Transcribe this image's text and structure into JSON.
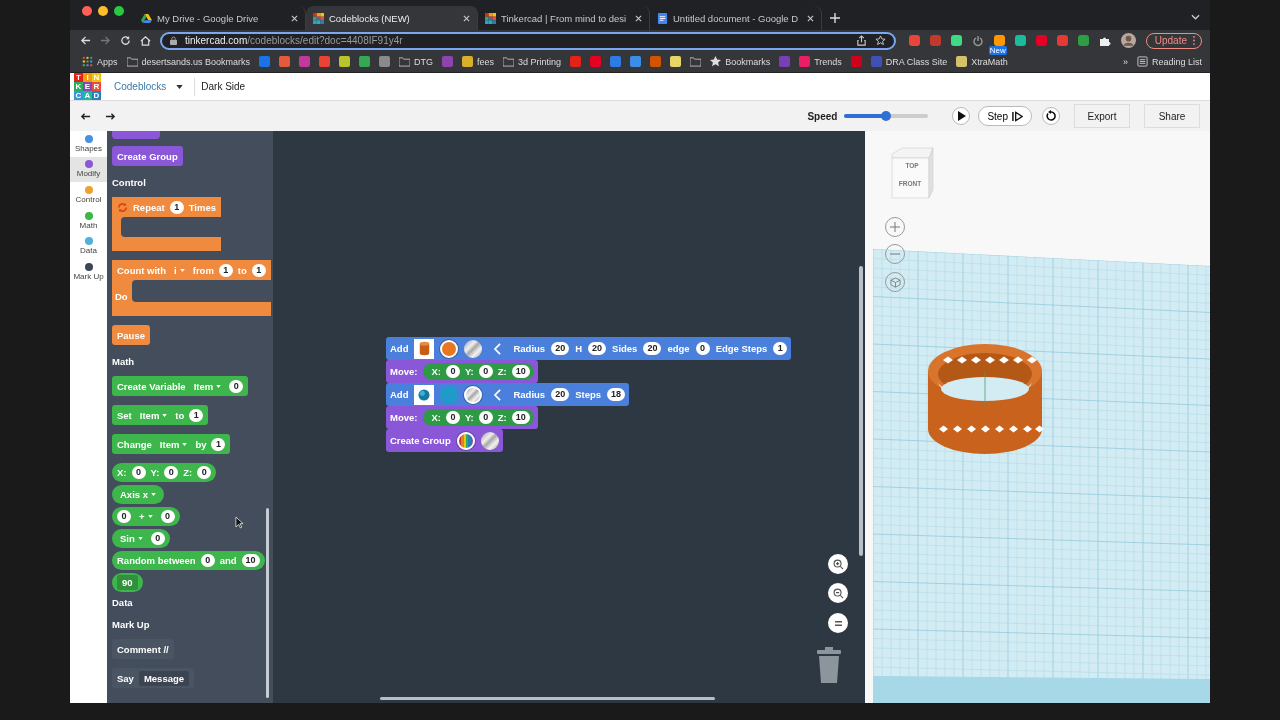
{
  "browser": {
    "tabs": [
      {
        "title": "My Drive - Google Drive",
        "selected": false
      },
      {
        "title": "Codeblocks (NEW)",
        "selected": true
      },
      {
        "title": "Tinkercad | From mind to desi",
        "selected": false
      },
      {
        "title": "Untitled document - Google D",
        "selected": false
      }
    ],
    "url": {
      "host": "tinkercad.com",
      "path": "/codeblocks/edit?doc=4408IF91y4r"
    },
    "extensions": [
      {
        "kind": "ext",
        "color": "#e8453c"
      },
      {
        "kind": "ext",
        "color": "#c0392b"
      },
      {
        "kind": "ext",
        "color": "#3ddc84"
      },
      {
        "kind": "power"
      },
      {
        "kind": "ext",
        "color": "#ff9800",
        "badge": "New"
      },
      {
        "kind": "ext",
        "color": "#1abc9c"
      },
      {
        "kind": "ext",
        "color": "#e60023"
      },
      {
        "kind": "ext",
        "color": "#e53935"
      },
      {
        "kind": "ext",
        "color": "#2e9e45"
      },
      {
        "kind": "puzzle"
      }
    ],
    "update_button": "Update",
    "bookmarks": [
      {
        "kind": "apps",
        "label": "Apps"
      },
      {
        "kind": "folder",
        "label": "desertsands.us Bookmarks"
      },
      {
        "kind": "favicon",
        "color": "#1a73e8"
      },
      {
        "kind": "favicon",
        "color": "#e5593c"
      },
      {
        "kind": "favicon",
        "color": "#c0399b"
      },
      {
        "kind": "favicon",
        "color": "#ea4335"
      },
      {
        "kind": "favicon",
        "color": "#b7c42c"
      },
      {
        "kind": "favicon",
        "color": "#34a853"
      },
      {
        "kind": "favicon",
        "color": "#8a8a8a"
      },
      {
        "kind": "folder",
        "label": "DTG"
      },
      {
        "kind": "favicon",
        "color": "#8e44ad"
      },
      {
        "kind": "site",
        "label": "fees",
        "color": "#d8b02a"
      },
      {
        "kind": "folder",
        "label": "3d Printing"
      },
      {
        "kind": "favicon",
        "color": "#e62117"
      },
      {
        "kind": "favicon",
        "color": "#e60023"
      },
      {
        "kind": "favicon",
        "color": "#2d7be5"
      },
      {
        "kind": "favicon",
        "color": "#3b8ee8"
      },
      {
        "kind": "favicon",
        "color": "#d35400"
      },
      {
        "kind": "favicon",
        "color": "#e8d56a"
      },
      {
        "kind": "folder"
      },
      {
        "kind": "star",
        "label": "Bookmarks"
      },
      {
        "kind": "favicon",
        "color": "#7b3fb5"
      },
      {
        "kind": "site",
        "label": "Trends",
        "color": "#e91e63"
      },
      {
        "kind": "favicon",
        "color": "#d0021b"
      },
      {
        "kind": "site",
        "label": "DRA Class Site",
        "color": "#3f51b5"
      },
      {
        "kind": "site",
        "label": "XtraMath",
        "color": "#d4c26a"
      }
    ],
    "overflow": "»",
    "reading_list": "Reading List"
  },
  "app": {
    "logo": [
      "T",
      "I",
      "N",
      "K",
      "E",
      "R",
      "C",
      "A",
      "D"
    ],
    "mode": "Codeblocks",
    "design_name": "Dark Side",
    "speed": {
      "label": "Speed",
      "level": 0.5
    },
    "step_button": "Step",
    "export_button": "Export",
    "share_button": "Share",
    "categories": [
      {
        "label": "Shapes",
        "color": "#4a90e2",
        "selected": false
      },
      {
        "label": "Modify",
        "color": "#8a57d8",
        "selected": true
      },
      {
        "label": "Control",
        "color": "#f0a030",
        "selected": false
      },
      {
        "label": "Math",
        "color": "#3db64b",
        "selected": false
      },
      {
        "label": "Data",
        "color": "#4fb0d8",
        "selected": false
      },
      {
        "label": "Mark Up",
        "color": "#3c4654",
        "selected": false
      }
    ]
  },
  "palette": [
    {
      "kind": "stub",
      "color": "#8a57d8"
    },
    {
      "kind": "block",
      "color": "#8a57d8",
      "parts": [
        {
          "kind": "label",
          "text": "Create Group"
        }
      ]
    },
    {
      "kind": "heading",
      "text": "Control"
    },
    {
      "kind": "c-block",
      "color": "#ef8a3e",
      "parts": [
        {
          "kind": "repeat"
        },
        {
          "kind": "label",
          "text": "Repeat"
        },
        {
          "kind": "number",
          "text": "1"
        },
        {
          "kind": "label",
          "text": "Times"
        }
      ]
    },
    {
      "kind": "c-block",
      "color": "#ef8a3e",
      "mouth_label": "Do",
      "parts": [
        {
          "kind": "label",
          "text": "Count with"
        },
        {
          "kind": "dropdown",
          "text": "i"
        },
        {
          "kind": "label",
          "text": "from"
        },
        {
          "kind": "number",
          "text": "1"
        },
        {
          "kind": "label",
          "text": "to"
        },
        {
          "kind": "number",
          "text": "1"
        }
      ]
    },
    {
      "kind": "block",
      "color": "#ef8a3e",
      "parts": [
        {
          "kind": "label",
          "text": "Pause"
        }
      ]
    },
    {
      "kind": "heading",
      "text": "Math"
    },
    {
      "kind": "block",
      "color": "#3db64b",
      "parts": [
        {
          "kind": "label",
          "text": "Create Variable"
        },
        {
          "kind": "dropdown",
          "text": "Item"
        },
        {
          "kind": "number",
          "text": "0"
        }
      ]
    },
    {
      "kind": "block",
      "color": "#3db64b",
      "parts": [
        {
          "kind": "label",
          "text": "Set"
        },
        {
          "kind": "dropdown",
          "text": "Item"
        },
        {
          "kind": "label",
          "text": "to"
        },
        {
          "kind": "number",
          "text": "1"
        }
      ]
    },
    {
      "kind": "block",
      "color": "#3db64b",
      "parts": [
        {
          "kind": "label",
          "text": "Change"
        },
        {
          "kind": "dropdown",
          "text": "Item"
        },
        {
          "kind": "label",
          "text": "by"
        },
        {
          "kind": "number",
          "text": "1"
        }
      ]
    },
    {
      "kind": "reporter",
      "color": "#3db64b",
      "parts": [
        {
          "kind": "label",
          "text": "X:"
        },
        {
          "kind": "number",
          "text": "0"
        },
        {
          "kind": "label",
          "text": "Y:"
        },
        {
          "kind": "number",
          "text": "0"
        },
        {
          "kind": "label",
          "text": "Z:"
        },
        {
          "kind": "number",
          "text": "0"
        }
      ]
    },
    {
      "kind": "reporter",
      "color": "#3db64b",
      "parts": [
        {
          "kind": "dropdown",
          "text": "Axis x"
        }
      ]
    },
    {
      "kind": "reporter",
      "color": "#3db64b",
      "parts": [
        {
          "kind": "number",
          "text": "0"
        },
        {
          "kind": "dropdown",
          "text": "+"
        },
        {
          "kind": "number",
          "text": "0"
        }
      ]
    },
    {
      "kind": "reporter",
      "color": "#3db64b",
      "parts": [
        {
          "kind": "dropdown",
          "text": "Sin"
        },
        {
          "kind": "number",
          "text": "0"
        }
      ]
    },
    {
      "kind": "reporter",
      "color": "#3db64b",
      "parts": [
        {
          "kind": "label",
          "text": "Random between"
        },
        {
          "kind": "number",
          "text": "0"
        },
        {
          "kind": "label",
          "text": "and"
        },
        {
          "kind": "number",
          "text": "10"
        }
      ]
    },
    {
      "kind": "reporter",
      "color": "#3db64b",
      "parts": [
        {
          "kind": "field",
          "text": "90"
        }
      ]
    },
    {
      "kind": "heading",
      "text": "Data"
    },
    {
      "kind": "heading",
      "text": "Mark Up"
    },
    {
      "kind": "block",
      "color": "#4a5564",
      "parts": [
        {
          "kind": "label",
          "text": "Comment //"
        }
      ]
    },
    {
      "kind": "block",
      "color": "#4a5564",
      "parts": [
        {
          "kind": "label",
          "text": "Say"
        },
        {
          "kind": "field",
          "text": "Message"
        }
      ]
    }
  ],
  "workspace": {
    "script": [
      {
        "color": "#4a80dc",
        "parts": [
          {
            "kind": "label",
            "text": "Add"
          },
          {
            "kind": "cylinder-thumb"
          },
          {
            "kind": "color-swatch",
            "color": "#e87722",
            "selected": true
          },
          {
            "kind": "metal-swatch",
            "selected": false
          },
          {
            "kind": "collapse"
          },
          {
            "kind": "label",
            "text": "Radius"
          },
          {
            "kind": "number",
            "text": "20"
          },
          {
            "kind": "label",
            "text": "H"
          },
          {
            "kind": "number",
            "text": "20"
          },
          {
            "kind": "label",
            "text": "Sides"
          },
          {
            "kind": "number",
            "text": "20"
          },
          {
            "kind": "label",
            "text": "edge"
          },
          {
            "kind": "number",
            "text": "0"
          },
          {
            "kind": "label",
            "text": "Edge Steps"
          },
          {
            "kind": "number",
            "text": "1"
          }
        ]
      },
      {
        "color": "#8a57d8",
        "parts": [
          {
            "kind": "label",
            "text": "Move:"
          },
          {
            "kind": "group",
            "parts": [
              {
                "kind": "label",
                "text": "X:"
              },
              {
                "kind": "number",
                "text": "0"
              },
              {
                "kind": "label",
                "text": "Y:"
              },
              {
                "kind": "number",
                "text": "0"
              },
              {
                "kind": "label",
                "text": "Z:"
              },
              {
                "kind": "number",
                "text": "10"
              }
            ]
          }
        ]
      },
      {
        "color": "#4a80dc",
        "parts": [
          {
            "kind": "label",
            "text": "Add"
          },
          {
            "kind": "sphere-thumb"
          },
          {
            "kind": "color-swatch",
            "color": "#1e9bc8",
            "selected": false
          },
          {
            "kind": "metal-swatch",
            "selected": true
          },
          {
            "kind": "collapse"
          },
          {
            "kind": "label",
            "text": "Radius"
          },
          {
            "kind": "number",
            "text": "20"
          },
          {
            "kind": "label",
            "text": "Steps"
          },
          {
            "kind": "number",
            "text": "18"
          }
        ]
      },
      {
        "color": "#8a57d8",
        "parts": [
          {
            "kind": "label",
            "text": "Move:"
          },
          {
            "kind": "group",
            "parts": [
              {
                "kind": "label",
                "text": "X:"
              },
              {
                "kind": "number",
                "text": "0"
              },
              {
                "kind": "label",
                "text": "Y:"
              },
              {
                "kind": "number",
                "text": "0"
              },
              {
                "kind": "label",
                "text": "Z:"
              },
              {
                "kind": "number",
                "text": "10"
              }
            ]
          }
        ]
      },
      {
        "color": "#8a57d8",
        "parts": [
          {
            "kind": "label",
            "text": "Create Group"
          },
          {
            "kind": "rainbow-swatch",
            "selected": true
          },
          {
            "kind": "metal-swatch",
            "selected": false
          }
        ]
      }
    ],
    "view_cube": {
      "top": "TOP",
      "front": "FRONT"
    }
  }
}
